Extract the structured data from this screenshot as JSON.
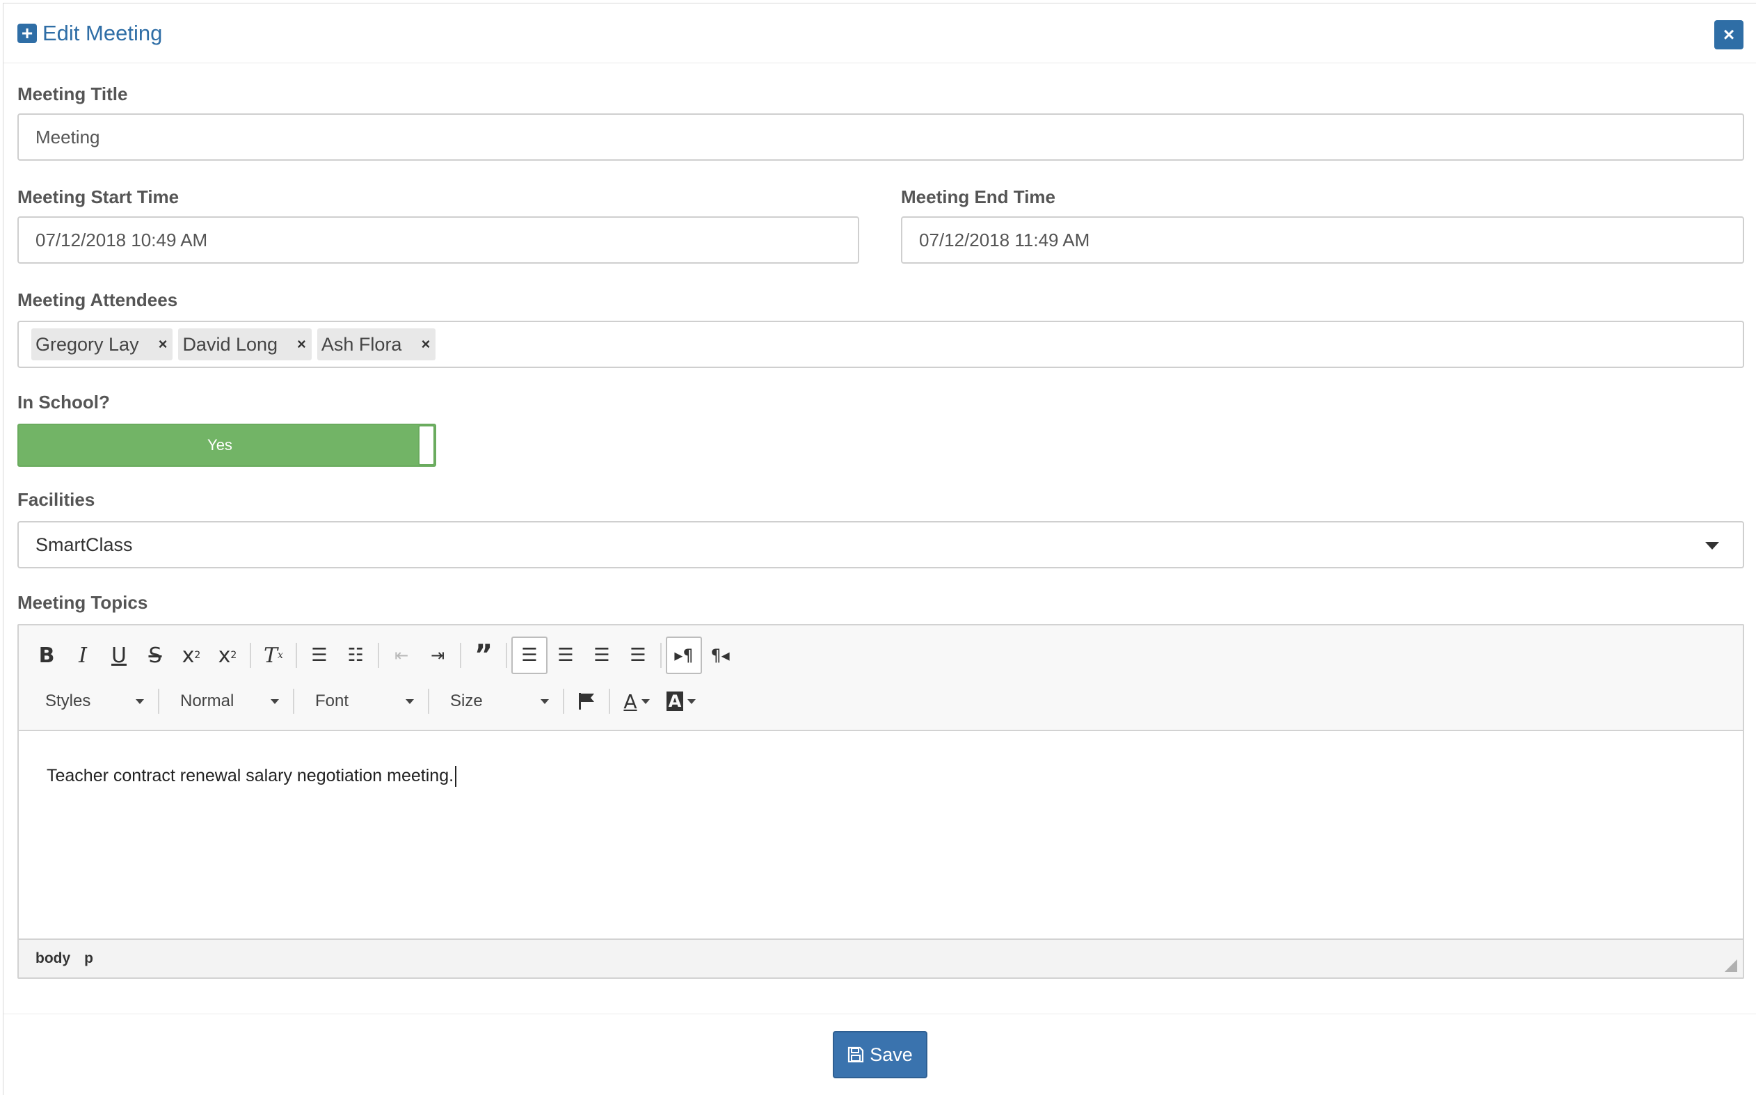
{
  "modal": {
    "title": "Edit Meeting",
    "close_label": "×"
  },
  "fields": {
    "title": {
      "label": "Meeting Title",
      "value": "Meeting"
    },
    "start_time": {
      "label": "Meeting Start Time",
      "value": "07/12/2018 10:49 AM"
    },
    "end_time": {
      "label": "Meeting End Time",
      "value": "07/12/2018 11:49 AM"
    },
    "attendees": {
      "label": "Meeting Attendees",
      "tags": [
        "Gregory Lay",
        "David Long",
        "Ash Flora"
      ],
      "remove_glyph": "×"
    },
    "in_school": {
      "label": "In School?",
      "value": "Yes",
      "color": "#72b466"
    },
    "facilities": {
      "label": "Facilities",
      "value": "SmartClass"
    },
    "topics": {
      "label": "Meeting Topics",
      "content": "Teacher contract renewal salary negotiation meeting.",
      "combos": [
        "Styles",
        "Normal",
        "Font",
        "Size"
      ],
      "path": [
        "body",
        "p"
      ]
    }
  },
  "footer": {
    "save_label": "Save"
  },
  "colors": {
    "primary": "#2f6ea6",
    "toggle_on": "#72b466"
  },
  "icons": [
    "plus-square-icon",
    "close-icon",
    "chevron-down-icon",
    "save-icon",
    "flag-icon",
    "resize-icon"
  ]
}
